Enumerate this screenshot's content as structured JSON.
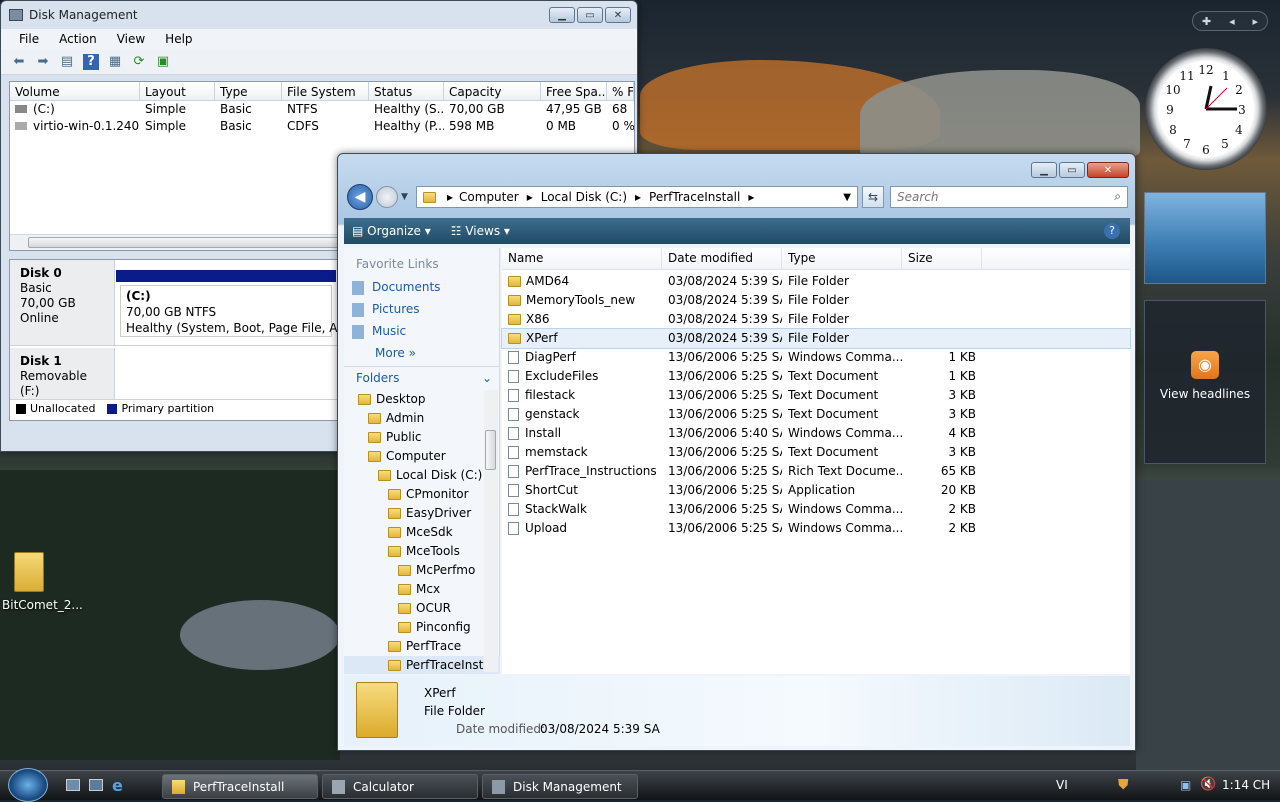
{
  "disk_management": {
    "title": "Disk Management",
    "menu": [
      "File",
      "Action",
      "View",
      "Help"
    ],
    "columns": [
      "Volume",
      "Layout",
      "Type",
      "File System",
      "Status",
      "Capacity",
      "Free Spa...",
      "% F"
    ],
    "rows": [
      [
        "(C:)",
        "Simple",
        "Basic",
        "NTFS",
        "Healthy (S...",
        "70,00 GB",
        "47,95 GB",
        "68"
      ],
      [
        "virtio-win-0.1.240 ...",
        "Simple",
        "Basic",
        "CDFS",
        "Healthy (P...",
        "598 MB",
        "0 MB",
        "0 %"
      ]
    ],
    "disk0": {
      "name": "Disk 0",
      "type": "Basic",
      "size": "70,00 GB",
      "status": "Online",
      "vol_label": "(C:)",
      "vol_size": "70,00 GB NTFS",
      "vol_status": "Healthy (System, Boot, Page File, Active,"
    },
    "disk1": {
      "name": "Disk 1",
      "type": "Removable (F:)"
    },
    "legend": {
      "unallocated": "Unallocated",
      "primary": "Primary partition"
    }
  },
  "explorer": {
    "breadcrumb": [
      "Computer",
      "Local Disk (C:)",
      "PerfTraceInstall"
    ],
    "search_placeholder": "Search",
    "toolbar": {
      "organize": "Organize",
      "views": "Views"
    },
    "favorite_links_title": "Favorite Links",
    "favorites": [
      "Documents",
      "Pictures",
      "Music"
    ],
    "more": "More",
    "folders_title": "Folders",
    "tree": [
      "Desktop",
      "Admin",
      "Public",
      "Computer",
      "Local Disk (C:)",
      "CPmonitor",
      "EasyDriver",
      "MceSdk",
      "MceTools",
      "McPerfmo",
      "Mcx",
      "OCUR",
      "Pinconfig",
      "PerfTrace",
      "PerfTraceInst"
    ],
    "columns": [
      "Name",
      "Date modified",
      "Type",
      "Size"
    ],
    "files": [
      {
        "name": "AMD64",
        "date": "03/08/2024 5:39 SA",
        "type": "File Folder",
        "size": "",
        "kind": "folder"
      },
      {
        "name": "MemoryTools_new",
        "date": "03/08/2024 5:39 SA",
        "type": "File Folder",
        "size": "",
        "kind": "folder"
      },
      {
        "name": "X86",
        "date": "03/08/2024 5:39 SA",
        "type": "File Folder",
        "size": "",
        "kind": "folder"
      },
      {
        "name": "XPerf",
        "date": "03/08/2024 5:39 SA",
        "type": "File Folder",
        "size": "",
        "kind": "folder"
      },
      {
        "name": "DiagPerf",
        "date": "13/06/2006 5:25 SA",
        "type": "Windows Comma...",
        "size": "1 KB",
        "kind": "doc"
      },
      {
        "name": "ExcludeFiles",
        "date": "13/06/2006 5:25 SA",
        "type": "Text Document",
        "size": "1 KB",
        "kind": "doc"
      },
      {
        "name": "filestack",
        "date": "13/06/2006 5:25 SA",
        "type": "Text Document",
        "size": "3 KB",
        "kind": "doc"
      },
      {
        "name": "genstack",
        "date": "13/06/2006 5:25 SA",
        "type": "Text Document",
        "size": "3 KB",
        "kind": "doc"
      },
      {
        "name": "Install",
        "date": "13/06/2006 5:40 SA",
        "type": "Windows Comma...",
        "size": "4 KB",
        "kind": "doc"
      },
      {
        "name": "memstack",
        "date": "13/06/2006 5:25 SA",
        "type": "Text Document",
        "size": "3 KB",
        "kind": "doc"
      },
      {
        "name": "PerfTrace_Instructions",
        "date": "13/06/2006 5:25 SA",
        "type": "Rich Text Docume...",
        "size": "65 KB",
        "kind": "doc"
      },
      {
        "name": "ShortCut",
        "date": "13/06/2006 5:25 SA",
        "type": "Application",
        "size": "20 KB",
        "kind": "doc"
      },
      {
        "name": "StackWalk",
        "date": "13/06/2006 5:25 SA",
        "type": "Windows Comma...",
        "size": "2 KB",
        "kind": "doc"
      },
      {
        "name": "Upload",
        "date": "13/06/2006 5:25 SA",
        "type": "Windows Comma...",
        "size": "2 KB",
        "kind": "doc"
      }
    ],
    "selected_index": 3,
    "details": {
      "name": "XPerf",
      "type": "File Folder",
      "date_label": "Date modified:",
      "date": "03/08/2024 5:39 SA"
    }
  },
  "desktop_icon": "BitComet_2...",
  "gadget_headlines": "View headlines",
  "taskbar": {
    "buttons": [
      "PerfTraceInstall",
      "Calculator",
      "Disk Management"
    ],
    "lang": "VI",
    "clock": "1:14 CH"
  }
}
